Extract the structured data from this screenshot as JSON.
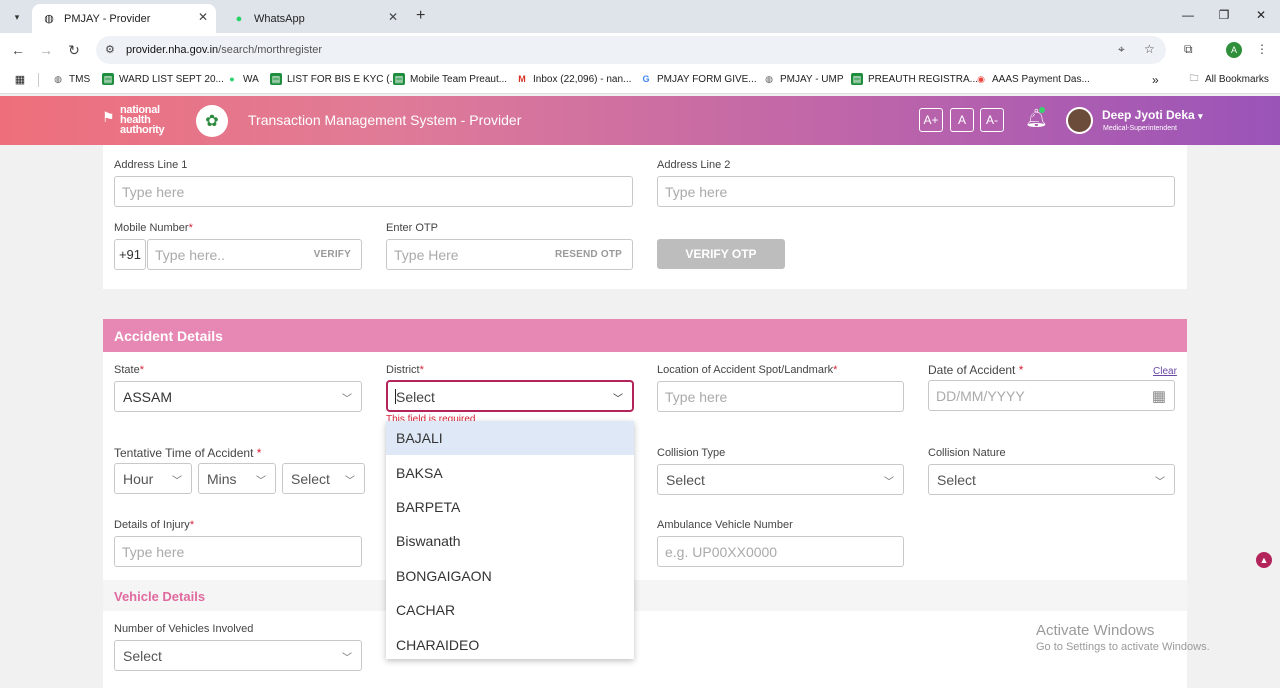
{
  "browser": {
    "tabs": [
      {
        "title": "PMJAY - Provider",
        "icon": "globe-icon"
      },
      {
        "title": "WhatsApp",
        "icon": "whatsapp-icon"
      }
    ],
    "url_host": "provider.nha.gov.in",
    "url_path": "/search/morthregister",
    "profile_initial": "A"
  },
  "bookmarks": [
    {
      "label": "TMS",
      "icon": "globe-icon",
      "color": "#555555"
    },
    {
      "label": "WARD LIST SEPT 20...",
      "icon": "sheets-icon",
      "color": "#1e8e3e"
    },
    {
      "label": "WA",
      "icon": "whatsapp-icon",
      "color": "#25d366"
    },
    {
      "label": "LIST FOR BIS E KYC (...",
      "icon": "sheets-icon",
      "color": "#1e8e3e"
    },
    {
      "label": "Mobile Team Preaut...",
      "icon": "sheets-icon",
      "color": "#1e8e3e"
    },
    {
      "label": "Inbox (22,096) - nan...",
      "icon": "gmail-icon",
      "color": "#d93025"
    },
    {
      "label": "PMJAY FORM GIVE...",
      "icon": "google-icon",
      "color": "#4285f4"
    },
    {
      "label": "PMJAY - UMP",
      "icon": "globe-icon",
      "color": "#555555"
    },
    {
      "label": "PREAUTH REGISTRA...",
      "icon": "sheets-icon",
      "color": "#1e8e3e"
    },
    {
      "label": "AAAS Payment Das...",
      "icon": "report-icon",
      "color": "#e8453c"
    }
  ],
  "bookmarks_more": "»",
  "all_bookmarks": "All Bookmarks",
  "header": {
    "logo_text_1": "national",
    "logo_text_2": "health",
    "logo_text_3": "authority",
    "title": "Transaction Management System - Provider",
    "font_buttons": [
      "A+",
      "A",
      "A-"
    ],
    "user_name": "Deep Jyoti Deka",
    "user_role": "Medical-Superintendent"
  },
  "address": {
    "line1_label": "Address Line 1",
    "line1_placeholder": "Type here",
    "line2_label": "Address Line 2",
    "line2_placeholder": "Type here"
  },
  "mobile": {
    "label": "Mobile Number",
    "prefix": "+91",
    "placeholder": "Type here..",
    "verify": "VERIFY"
  },
  "otp": {
    "label": "Enter OTP",
    "placeholder": "Type Here",
    "resend": "RESEND OTP",
    "verify_button": "VERIFY OTP"
  },
  "required_mark": "*",
  "accident": {
    "section_title": "Accident Details",
    "state_label": "State",
    "state_value": "ASSAM",
    "district_label": "District",
    "district_value": "Select",
    "district_error": "This field is required",
    "location_label": "Location of Accident Spot/Landmark",
    "location_placeholder": "Type here",
    "date_label": "Date of Accident",
    "date_placeholder": "DD/MM/YYYY",
    "clear_label": "Clear",
    "time_label": "Tentative Time of Accident",
    "hour": "Hour",
    "mins": "Mins",
    "ampm": "Select",
    "collision_type_label": "Collision Type",
    "collision_type_value": "Select",
    "collision_nature_label": "Collision Nature",
    "collision_nature_value": "Select",
    "injury_label": "Details of Injury",
    "injury_placeholder": "Type here",
    "ambulance_label": "Ambulance Vehicle Number",
    "ambulance_placeholder": "e.g. UP00XX0000"
  },
  "district_options": [
    "BAJALI",
    "BAKSA",
    "BARPETA",
    "Biswanath",
    "BONGAIGAON",
    "CACHAR",
    "CHARAIDEO"
  ],
  "vehicle": {
    "section_title": "Vehicle Details",
    "count_label": "Number of Vehicles Involved",
    "count_value": "Select"
  },
  "watermark": {
    "line1": "Activate Windows",
    "line2": "Go to Settings to activate Windows."
  },
  "colors": {
    "header_start": "#ee6f7b",
    "header_end": "#9a54b8",
    "section_bar": "#e787b3",
    "required": "#d9243b",
    "accent": "#b3245a"
  }
}
